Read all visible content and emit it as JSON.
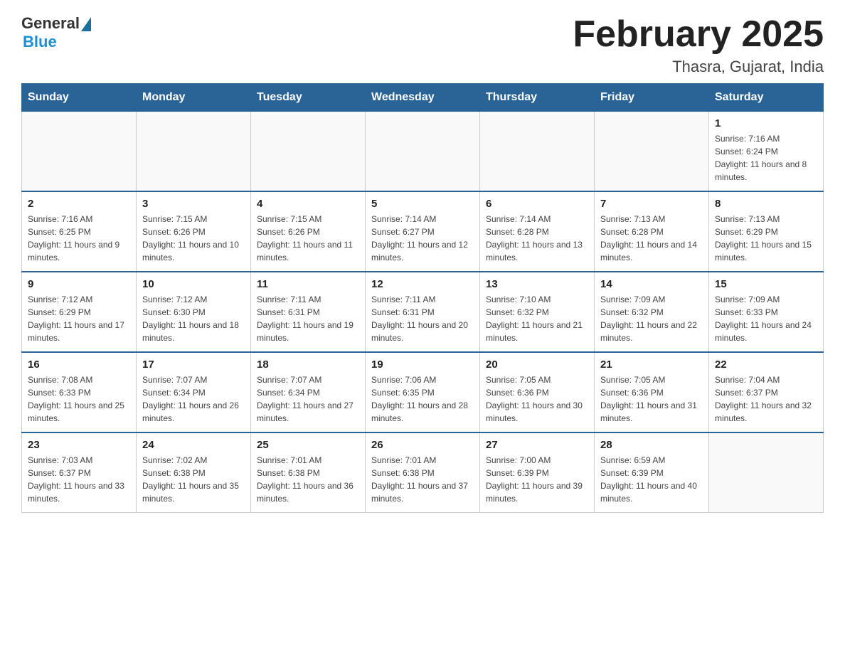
{
  "header": {
    "logo_general": "General",
    "logo_blue": "Blue",
    "month_year": "February 2025",
    "location": "Thasra, Gujarat, India"
  },
  "days_of_week": [
    "Sunday",
    "Monday",
    "Tuesday",
    "Wednesday",
    "Thursday",
    "Friday",
    "Saturday"
  ],
  "weeks": [
    [
      {
        "day": "",
        "info": ""
      },
      {
        "day": "",
        "info": ""
      },
      {
        "day": "",
        "info": ""
      },
      {
        "day": "",
        "info": ""
      },
      {
        "day": "",
        "info": ""
      },
      {
        "day": "",
        "info": ""
      },
      {
        "day": "1",
        "info": "Sunrise: 7:16 AM\nSunset: 6:24 PM\nDaylight: 11 hours and 8 minutes."
      }
    ],
    [
      {
        "day": "2",
        "info": "Sunrise: 7:16 AM\nSunset: 6:25 PM\nDaylight: 11 hours and 9 minutes."
      },
      {
        "day": "3",
        "info": "Sunrise: 7:15 AM\nSunset: 6:26 PM\nDaylight: 11 hours and 10 minutes."
      },
      {
        "day": "4",
        "info": "Sunrise: 7:15 AM\nSunset: 6:26 PM\nDaylight: 11 hours and 11 minutes."
      },
      {
        "day": "5",
        "info": "Sunrise: 7:14 AM\nSunset: 6:27 PM\nDaylight: 11 hours and 12 minutes."
      },
      {
        "day": "6",
        "info": "Sunrise: 7:14 AM\nSunset: 6:28 PM\nDaylight: 11 hours and 13 minutes."
      },
      {
        "day": "7",
        "info": "Sunrise: 7:13 AM\nSunset: 6:28 PM\nDaylight: 11 hours and 14 minutes."
      },
      {
        "day": "8",
        "info": "Sunrise: 7:13 AM\nSunset: 6:29 PM\nDaylight: 11 hours and 15 minutes."
      }
    ],
    [
      {
        "day": "9",
        "info": "Sunrise: 7:12 AM\nSunset: 6:29 PM\nDaylight: 11 hours and 17 minutes."
      },
      {
        "day": "10",
        "info": "Sunrise: 7:12 AM\nSunset: 6:30 PM\nDaylight: 11 hours and 18 minutes."
      },
      {
        "day": "11",
        "info": "Sunrise: 7:11 AM\nSunset: 6:31 PM\nDaylight: 11 hours and 19 minutes."
      },
      {
        "day": "12",
        "info": "Sunrise: 7:11 AM\nSunset: 6:31 PM\nDaylight: 11 hours and 20 minutes."
      },
      {
        "day": "13",
        "info": "Sunrise: 7:10 AM\nSunset: 6:32 PM\nDaylight: 11 hours and 21 minutes."
      },
      {
        "day": "14",
        "info": "Sunrise: 7:09 AM\nSunset: 6:32 PM\nDaylight: 11 hours and 22 minutes."
      },
      {
        "day": "15",
        "info": "Sunrise: 7:09 AM\nSunset: 6:33 PM\nDaylight: 11 hours and 24 minutes."
      }
    ],
    [
      {
        "day": "16",
        "info": "Sunrise: 7:08 AM\nSunset: 6:33 PM\nDaylight: 11 hours and 25 minutes."
      },
      {
        "day": "17",
        "info": "Sunrise: 7:07 AM\nSunset: 6:34 PM\nDaylight: 11 hours and 26 minutes."
      },
      {
        "day": "18",
        "info": "Sunrise: 7:07 AM\nSunset: 6:34 PM\nDaylight: 11 hours and 27 minutes."
      },
      {
        "day": "19",
        "info": "Sunrise: 7:06 AM\nSunset: 6:35 PM\nDaylight: 11 hours and 28 minutes."
      },
      {
        "day": "20",
        "info": "Sunrise: 7:05 AM\nSunset: 6:36 PM\nDaylight: 11 hours and 30 minutes."
      },
      {
        "day": "21",
        "info": "Sunrise: 7:05 AM\nSunset: 6:36 PM\nDaylight: 11 hours and 31 minutes."
      },
      {
        "day": "22",
        "info": "Sunrise: 7:04 AM\nSunset: 6:37 PM\nDaylight: 11 hours and 32 minutes."
      }
    ],
    [
      {
        "day": "23",
        "info": "Sunrise: 7:03 AM\nSunset: 6:37 PM\nDaylight: 11 hours and 33 minutes."
      },
      {
        "day": "24",
        "info": "Sunrise: 7:02 AM\nSunset: 6:38 PM\nDaylight: 11 hours and 35 minutes."
      },
      {
        "day": "25",
        "info": "Sunrise: 7:01 AM\nSunset: 6:38 PM\nDaylight: 11 hours and 36 minutes."
      },
      {
        "day": "26",
        "info": "Sunrise: 7:01 AM\nSunset: 6:38 PM\nDaylight: 11 hours and 37 minutes."
      },
      {
        "day": "27",
        "info": "Sunrise: 7:00 AM\nSunset: 6:39 PM\nDaylight: 11 hours and 39 minutes."
      },
      {
        "day": "28",
        "info": "Sunrise: 6:59 AM\nSunset: 6:39 PM\nDaylight: 11 hours and 40 minutes."
      },
      {
        "day": "",
        "info": ""
      }
    ]
  ]
}
